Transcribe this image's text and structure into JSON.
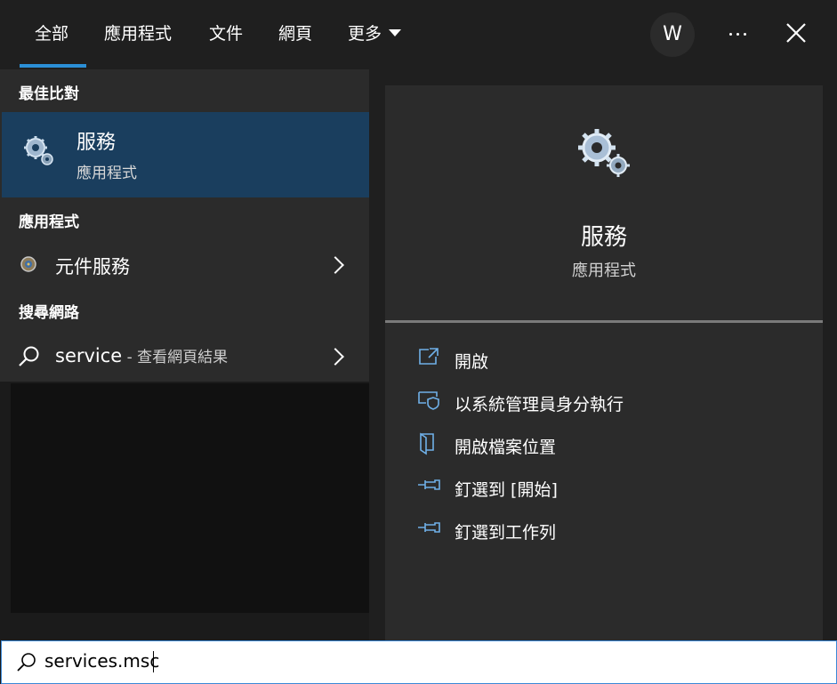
{
  "nav": {
    "tabs": [
      {
        "label": "全部"
      },
      {
        "label": "應用程式"
      },
      {
        "label": "文件"
      },
      {
        "label": "網頁"
      },
      {
        "label": "更多"
      }
    ],
    "avatar_letter": "W"
  },
  "left": {
    "best_match_heading": "最佳比對",
    "best_match": {
      "title": "服務",
      "subtitle": "應用程式"
    },
    "apps_heading": "應用程式",
    "apps": [
      {
        "label": "元件服務"
      }
    ],
    "web_heading": "搜尋網路",
    "web": {
      "query": "service",
      "suffix": " - 查看網頁結果"
    }
  },
  "preview": {
    "title": "服務",
    "subtitle": "應用程式",
    "actions": [
      {
        "label": "開啟",
        "icon": "open-external-icon"
      },
      {
        "label": "以系統管理員身分執行",
        "icon": "shield-icon"
      },
      {
        "label": "開啟檔案位置",
        "icon": "folder-icon"
      },
      {
        "label": "釘選到 [開始]",
        "icon": "pin-icon"
      },
      {
        "label": "釘選到工作列",
        "icon": "pin-icon"
      }
    ]
  },
  "search": {
    "value": "services.msc"
  },
  "colors": {
    "accent": "#2b8fd6",
    "selected": "#1a3e5e",
    "icon_blue": "#6fb0e8"
  }
}
